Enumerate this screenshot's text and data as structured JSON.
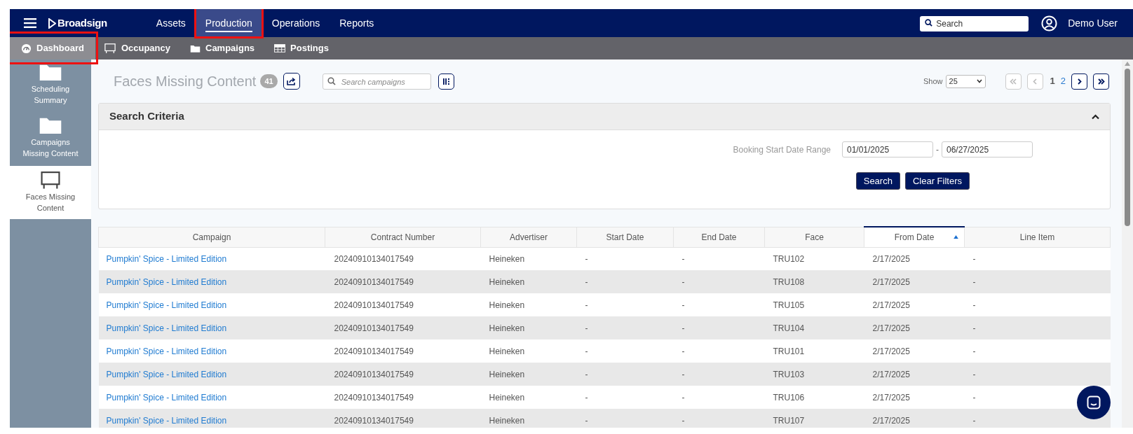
{
  "topbar": {
    "logo": "Broadsign",
    "nav": [
      {
        "label": "Assets",
        "selected": false,
        "highlighted": false
      },
      {
        "label": "Production",
        "selected": true,
        "highlighted": true
      },
      {
        "label": "Operations",
        "selected": false,
        "highlighted": false
      },
      {
        "label": "Reports",
        "selected": false,
        "highlighted": false
      }
    ],
    "search": {
      "placeholder": "Search"
    },
    "user": "Demo User"
  },
  "subnav": [
    {
      "label": "Dashboard",
      "selected": true,
      "highlighted": true
    },
    {
      "label": "Occupancy",
      "selected": false,
      "highlighted": false
    },
    {
      "label": "Campaigns",
      "selected": false,
      "highlighted": false
    },
    {
      "label": "Postings",
      "selected": false,
      "highlighted": false
    }
  ],
  "sidebar": {
    "items": [
      {
        "label": "Scheduling Summary",
        "selected": false
      },
      {
        "label": "Campaigns Missing Content",
        "selected": false
      },
      {
        "label": "Faces Missing Content",
        "selected": true
      }
    ]
  },
  "header": {
    "title": "Faces Missing Content",
    "count": "41",
    "search_placeholder": "Search campaigns",
    "show_label": "Show",
    "page_size": "25",
    "pages": [
      {
        "label": "1",
        "selected": true
      },
      {
        "label": "2",
        "selected": false
      }
    ]
  },
  "search_criteria": {
    "title": "Search Criteria",
    "range_label": "Booking Start Date Range",
    "from": "01/01/2025",
    "separator": "-",
    "to": "06/27/2025",
    "buttons": [
      "Search",
      "Clear Filters"
    ]
  },
  "table": {
    "columns": [
      {
        "label": "Campaign",
        "sorted": false
      },
      {
        "label": "Contract Number",
        "sorted": false
      },
      {
        "label": "Advertiser",
        "sorted": false
      },
      {
        "label": "Start Date",
        "sorted": false
      },
      {
        "label": "End Date",
        "sorted": false
      },
      {
        "label": "Face",
        "sorted": false
      },
      {
        "label": "From Date",
        "sorted": true
      },
      {
        "label": "Line Item",
        "sorted": false
      }
    ],
    "rows": [
      [
        "Pumpkin' Spice - Limited Edition",
        "20240910134017549",
        "Heineken",
        "-",
        "-",
        "TRU102",
        "2/17/2025",
        "-"
      ],
      [
        "Pumpkin' Spice - Limited Edition",
        "20240910134017549",
        "Heineken",
        "-",
        "-",
        "TRU108",
        "2/17/2025",
        "-"
      ],
      [
        "Pumpkin' Spice - Limited Edition",
        "20240910134017549",
        "Heineken",
        "-",
        "-",
        "TRU105",
        "2/17/2025",
        "-"
      ],
      [
        "Pumpkin' Spice - Limited Edition",
        "20240910134017549",
        "Heineken",
        "-",
        "-",
        "TRU104",
        "2/17/2025",
        "-"
      ],
      [
        "Pumpkin' Spice - Limited Edition",
        "20240910134017549",
        "Heineken",
        "-",
        "-",
        "TRU101",
        "2/17/2025",
        "-"
      ],
      [
        "Pumpkin' Spice - Limited Edition",
        "20240910134017549",
        "Heineken",
        "-",
        "-",
        "TRU103",
        "2/17/2025",
        "-"
      ],
      [
        "Pumpkin' Spice - Limited Edition",
        "20240910134017549",
        "Heineken",
        "-",
        "-",
        "TRU106",
        "2/17/2025",
        "-"
      ],
      [
        "Pumpkin' Spice - Limited Edition",
        "20240910134017549",
        "Heineken",
        "-",
        "-",
        "TRU107",
        "2/17/2025",
        "-"
      ]
    ]
  }
}
